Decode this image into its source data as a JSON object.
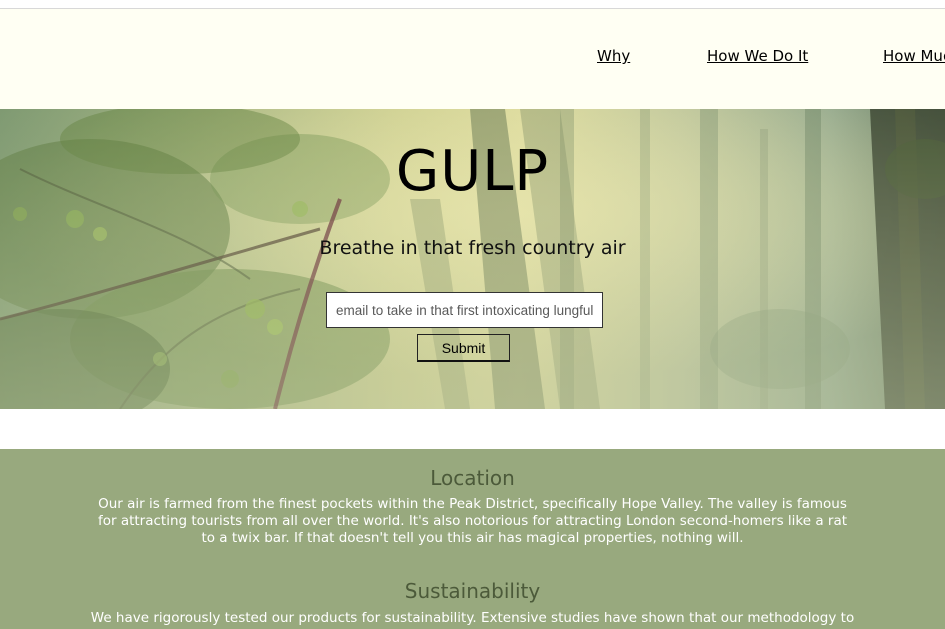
{
  "nav": {
    "items": [
      {
        "label": "Why"
      },
      {
        "label": "How We Do It"
      },
      {
        "label": "How Much"
      }
    ]
  },
  "hero": {
    "title": "GULP",
    "subtitle": "Breathe in that fresh country air",
    "email_placeholder": "email to take in that first intoxicating lungful",
    "submit_label": "Submit",
    "background_image": "misty-forest"
  },
  "features": [
    {
      "heading": "Location",
      "text": "Our air is farmed from the finest pockets within the Peak District, specifically Hope Valley. The valley is famous for attracting tourists from all over the world. It's also notorious for attracting London second-homers like a rat to a twix bar. If that doesn't tell you this air has magical properties, nothing will."
    },
    {
      "heading": "Sustainability",
      "text": "We have rigorously tested our products for sustainability. Extensive studies have shown that our methodology to"
    }
  ],
  "colors": {
    "nav_background": "#fffff3",
    "features_background": "#98a97e",
    "heading_color": "#4c5a3a",
    "body_text_color": "#ffffff"
  }
}
